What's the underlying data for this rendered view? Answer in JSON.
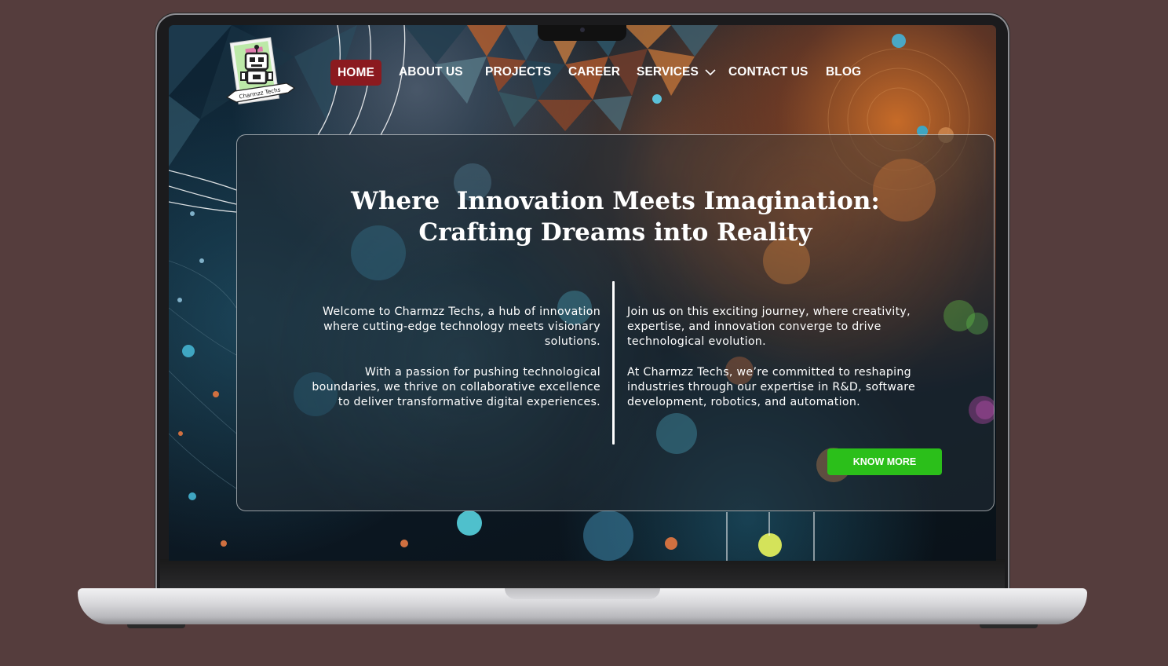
{
  "brand": {
    "logo_text": "Charmzz Techs"
  },
  "nav": {
    "items": [
      {
        "label": "HOME",
        "active": true
      },
      {
        "label": "ABOUT US",
        "active": false
      },
      {
        "label": "PROJECTS",
        "active": false
      },
      {
        "label": "CAREER",
        "active": false
      },
      {
        "label": "SERVICES",
        "active": false,
        "has_dropdown": true
      },
      {
        "label": "CONTACT US",
        "active": false
      },
      {
        "label": "BLOG",
        "active": false
      }
    ],
    "active_color": "#8b1a1f"
  },
  "hero": {
    "headline_line1": "Where  Innovation Meets Imagination:",
    "headline_line2": "Crafting Dreams into Reality",
    "left_paragraphs": [
      "Welcome to Charmzz Techs, a hub of innovation where cutting-edge technology meets visionary solutions.",
      "With a passion for pushing technological boundaries, we thrive on collaborative excellence to deliver transformative digital experiences."
    ],
    "right_paragraphs": [
      "Join us on this exciting journey, where creativity, expertise, and innovation converge to drive technological evolution.",
      "At Charmzz Techs, we’re committed to reshaping industries through our expertise in R&D, software development, robotics, and automation."
    ],
    "cta_label": "KNOW MORE",
    "cta_color": "#2bbf1a"
  },
  "colors": {
    "backdrop": "#553d3d"
  }
}
